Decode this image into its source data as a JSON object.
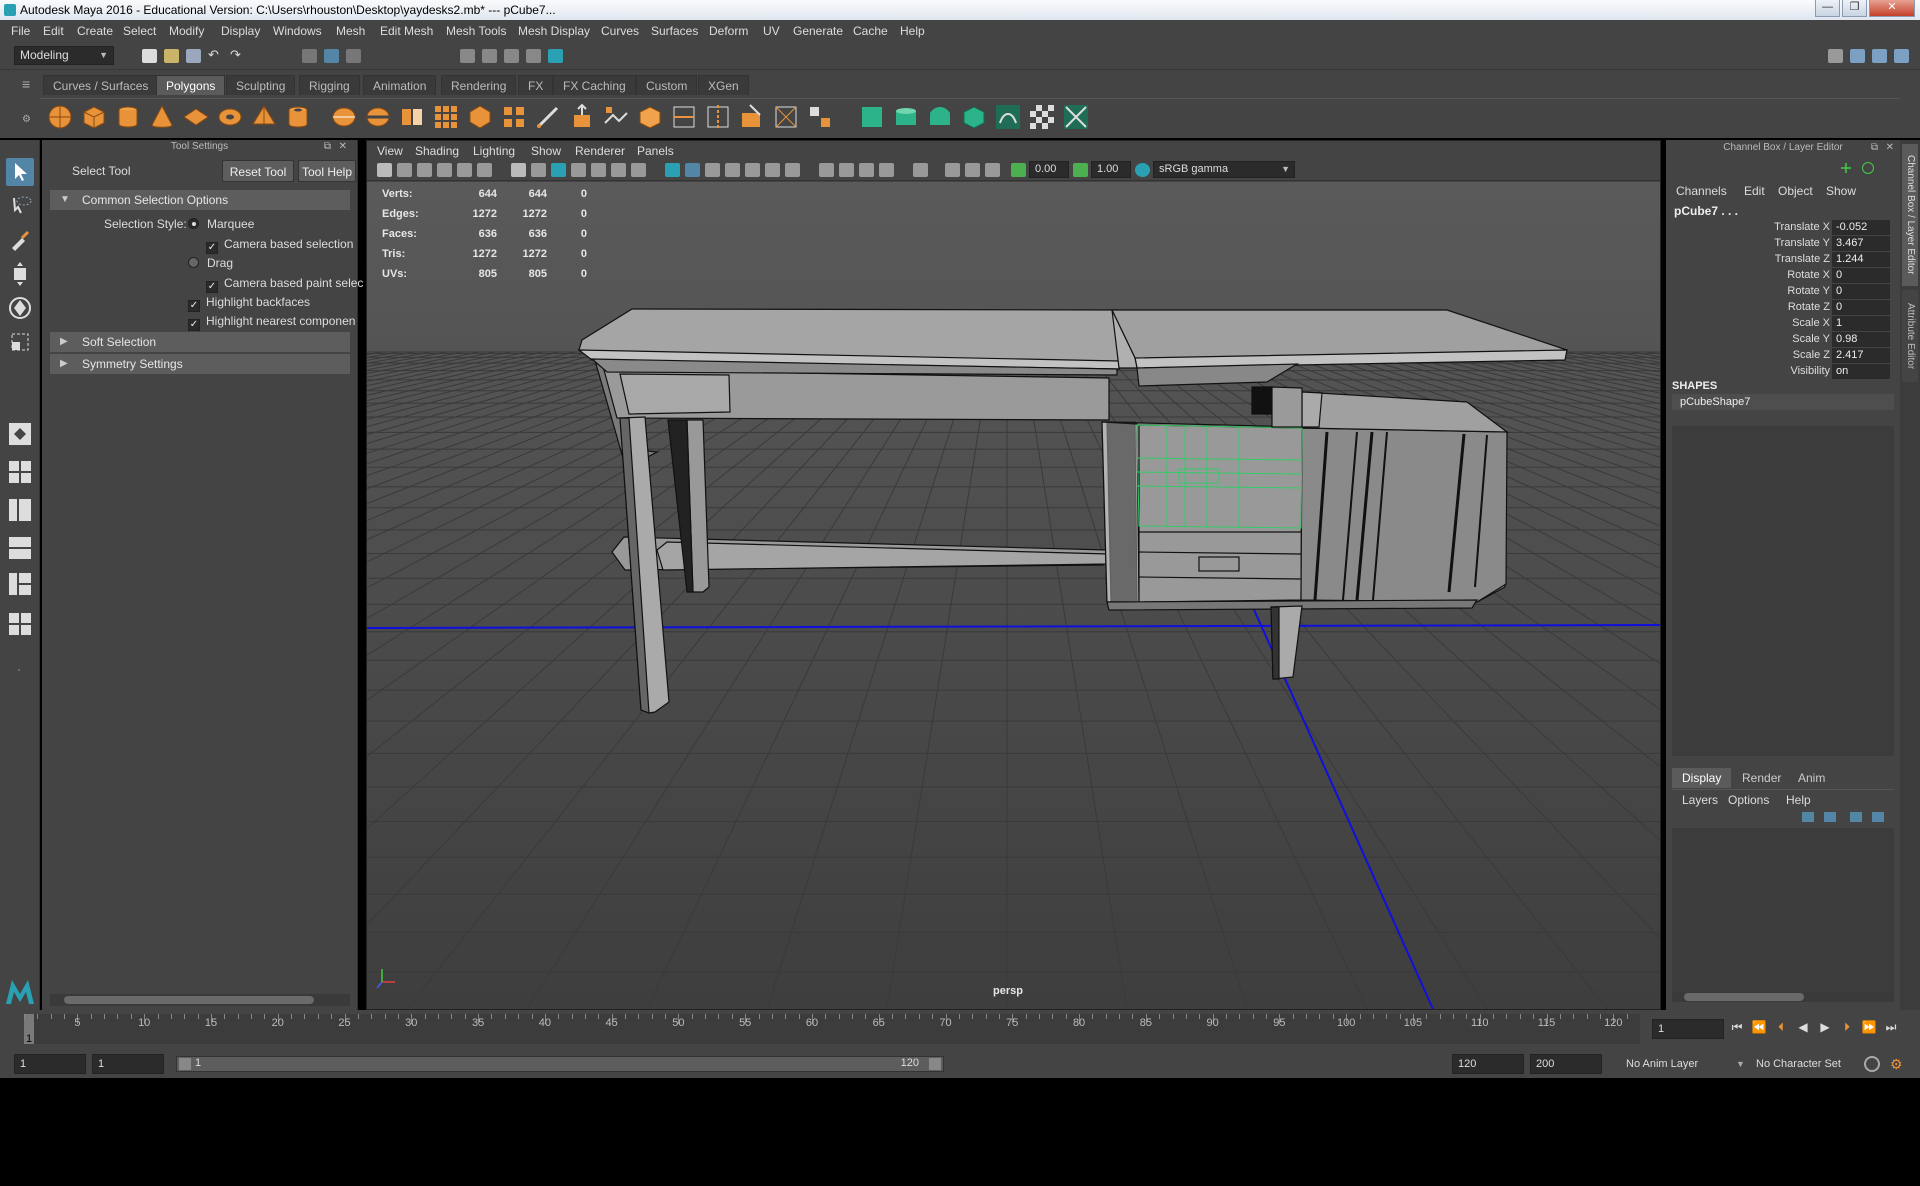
{
  "window": {
    "title": "Autodesk Maya 2016 - Educational Version: C:\\Users\\rhouston\\Desktop\\yaydesks2.mb*   ---   pCube7...",
    "minimize": "—",
    "maximize": "❐",
    "close": "✕"
  },
  "menubar": [
    "File",
    "Edit",
    "Create",
    "Select",
    "Modify",
    "Display",
    "Windows",
    "Mesh",
    "Edit Mesh",
    "Mesh Tools",
    "Mesh Display",
    "Curves",
    "Surfaces",
    "Deform",
    "UV",
    "Generate",
    "Cache",
    "Help"
  ],
  "statusline": {
    "mode": "Modeling"
  },
  "shelf": {
    "tabs": [
      "Curves / Surfaces",
      "Polygons",
      "Sculpting",
      "Rigging",
      "Animation",
      "Rendering",
      "FX",
      "FX Caching",
      "Custom",
      "XGen"
    ],
    "active_tab": "Polygons"
  },
  "tool_settings": {
    "header": "Tool Settings",
    "tool_name": "Select Tool",
    "reset_button": "Reset Tool",
    "help_button": "Tool Help",
    "common_section": "Common Selection Options",
    "selection_style_label": "Selection Style:",
    "marquee": "Marquee",
    "camera_based_selection": "Camera based selection",
    "drag": "Drag",
    "camera_based_paint": "Camera based paint selec",
    "highlight_backfaces": "Highlight backfaces",
    "highlight_nearest": "Highlight nearest componen",
    "soft_selection": "Soft Selection",
    "symmetry_settings": "Symmetry Settings"
  },
  "viewport": {
    "menus": [
      "View",
      "Shading",
      "Lighting",
      "Show",
      "Renderer",
      "Panels"
    ],
    "exposure": "0.00",
    "gamma": "1.00",
    "color_space": "sRGB gamma",
    "camera_label": "persp",
    "hud": [
      {
        "label": "Verts:",
        "a": "644",
        "b": "644",
        "c": "0"
      },
      {
        "label": "Edges:",
        "a": "1272",
        "b": "1272",
        "c": "0"
      },
      {
        "label": "Faces:",
        "a": "636",
        "b": "636",
        "c": "0"
      },
      {
        "label": "Tris:",
        "a": "1272",
        "b": "1272",
        "c": "0"
      },
      {
        "label": "UVs:",
        "a": "805",
        "b": "805",
        "c": "0"
      }
    ]
  },
  "channel_box": {
    "header": "Channel Box / Layer Editor",
    "menus": [
      "Channels",
      "Edit",
      "Object",
      "Show"
    ],
    "object": "pCube7 . . .",
    "attributes": [
      {
        "label": "Translate X",
        "value": "-0.052"
      },
      {
        "label": "Translate Y",
        "value": "3.467"
      },
      {
        "label": "Translate Z",
        "value": "1.244"
      },
      {
        "label": "Rotate X",
        "value": "0"
      },
      {
        "label": "Rotate Y",
        "value": "0"
      },
      {
        "label": "Rotate Z",
        "value": "0"
      },
      {
        "label": "Scale X",
        "value": "1"
      },
      {
        "label": "Scale Y",
        "value": "0.98"
      },
      {
        "label": "Scale Z",
        "value": "2.417"
      },
      {
        "label": "Visibility",
        "value": "on"
      }
    ],
    "shapes_header": "SHAPES",
    "shape_name": "pCubeShape7",
    "layer_tabs": [
      "Display",
      "Render",
      "Anim"
    ],
    "layer_menus": [
      "Layers",
      "Options",
      "Help"
    ],
    "side_tab_1": "Channel Box / Layer Editor",
    "side_tab_2": "Attribute Editor"
  },
  "timeline": {
    "ticks": [
      "5",
      "10",
      "15",
      "20",
      "25",
      "30",
      "35",
      "40",
      "45",
      "50",
      "55",
      "60",
      "65",
      "70",
      "75",
      "80",
      "85",
      "90",
      "95",
      "100",
      "105",
      "110",
      "115",
      "120"
    ],
    "current_frame": "1",
    "current_frame_field": "1",
    "range_start": "1",
    "range_inner_start": "1",
    "range_slider_start": "1",
    "range_slider_end": "120",
    "range_end": "120",
    "range_max": "200",
    "anim_layer": "No Anim Layer",
    "character_set": "No Character Set"
  },
  "colors": {
    "panel": "#444444",
    "selected_wire": "#33cc66",
    "axis_blue": "#1010dd"
  }
}
